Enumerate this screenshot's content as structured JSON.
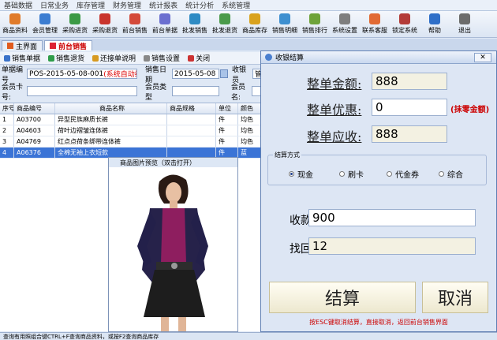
{
  "menu": [
    "基础数据",
    "日常业务",
    "库存管理",
    "财务管理",
    "统计报表",
    "统计分析",
    "系统管理"
  ],
  "toolbar": [
    {
      "label": "商品资料",
      "color": "#e07b2a"
    },
    {
      "label": "会员管理",
      "color": "#3c7dd1"
    },
    {
      "label": "采购进货",
      "color": "#3c9a45"
    },
    {
      "label": "采购退货",
      "color": "#c9342d"
    },
    {
      "label": "前台销售",
      "color": "#d44a3a"
    },
    {
      "label": "前台单据",
      "color": "#6b6fd0"
    },
    {
      "label": "批发销售",
      "color": "#2e8bc4"
    },
    {
      "label": "批发退货",
      "color": "#4b9b4b"
    },
    {
      "label": "商品库存",
      "color": "#d9a21e"
    },
    {
      "label": "销售明细",
      "color": "#3d8fd0"
    },
    {
      "label": "销售排行",
      "color": "#6ea33a"
    },
    {
      "label": "系统设置",
      "color": "#7e7e7e"
    },
    {
      "label": "联系客服",
      "color": "#e16a34"
    },
    {
      "label": "锁定系统",
      "color": "#b33b38"
    },
    {
      "label": "帮助",
      "color": "#2f6fc8"
    },
    {
      "label": "退出",
      "color": "#6c6c6c"
    }
  ],
  "tabs": {
    "home": "主界面",
    "front": "前台销售"
  },
  "subbar": {
    "bill": "销售单据",
    "ret": "销售退货",
    "pending": "还接单说明",
    "setting": "销售设置",
    "close": "关闭"
  },
  "form": {
    "bill_no_label": "单据编号",
    "bill_no": "POS-2015-05-08-001",
    "bill_no_hint": "(系统自动编号)",
    "date_label": "销售日期",
    "date": "2015-05-08",
    "cashier_label": "收银员",
    "cashier": "管理",
    "card_label": "会员卡号:",
    "type_label": "会员类型",
    "member_label": "会员名:"
  },
  "grid": {
    "headers": [
      "序号",
      "商品编号",
      "商品名称",
      "商品规格",
      "单位",
      "颜色"
    ],
    "rows": [
      [
        "1",
        "A03700",
        "异型民族麻质长裤",
        "",
        "件",
        "均色"
      ],
      [
        "2",
        "A04603",
        "荷叶边褶皱连体裤",
        "",
        "件",
        "均色"
      ],
      [
        "3",
        "A04769",
        "红点点荷条绑带连体裤",
        "",
        "件",
        "均色"
      ],
      [
        "4",
        "A06376",
        "全棉无袖上衣短款",
        "",
        "件",
        "蓝"
      ]
    ]
  },
  "imgwin": {
    "title": "商品图片预览（双击打开）"
  },
  "dialog": {
    "title": "收银结算",
    "total_label": "整单金额:",
    "total": "888",
    "discount_label": "整单优惠:",
    "discount": "0",
    "discount_note": "(抹零金额)",
    "due_label": "整单应收:",
    "due": "888",
    "pay_group": "结算方式",
    "methods": [
      "现金",
      "刷卡",
      "代金券",
      "综合"
    ],
    "received_label": "收款:",
    "received": "900",
    "change_label": "找回:",
    "change": "12",
    "settle": "结算",
    "cancel": "取消",
    "footer": "按ESC键取消结算，直接取消，返回前台销售界面"
  },
  "status": "查询有用照组合键CTRL+F查询商品资料，或按F2查询商品库存"
}
